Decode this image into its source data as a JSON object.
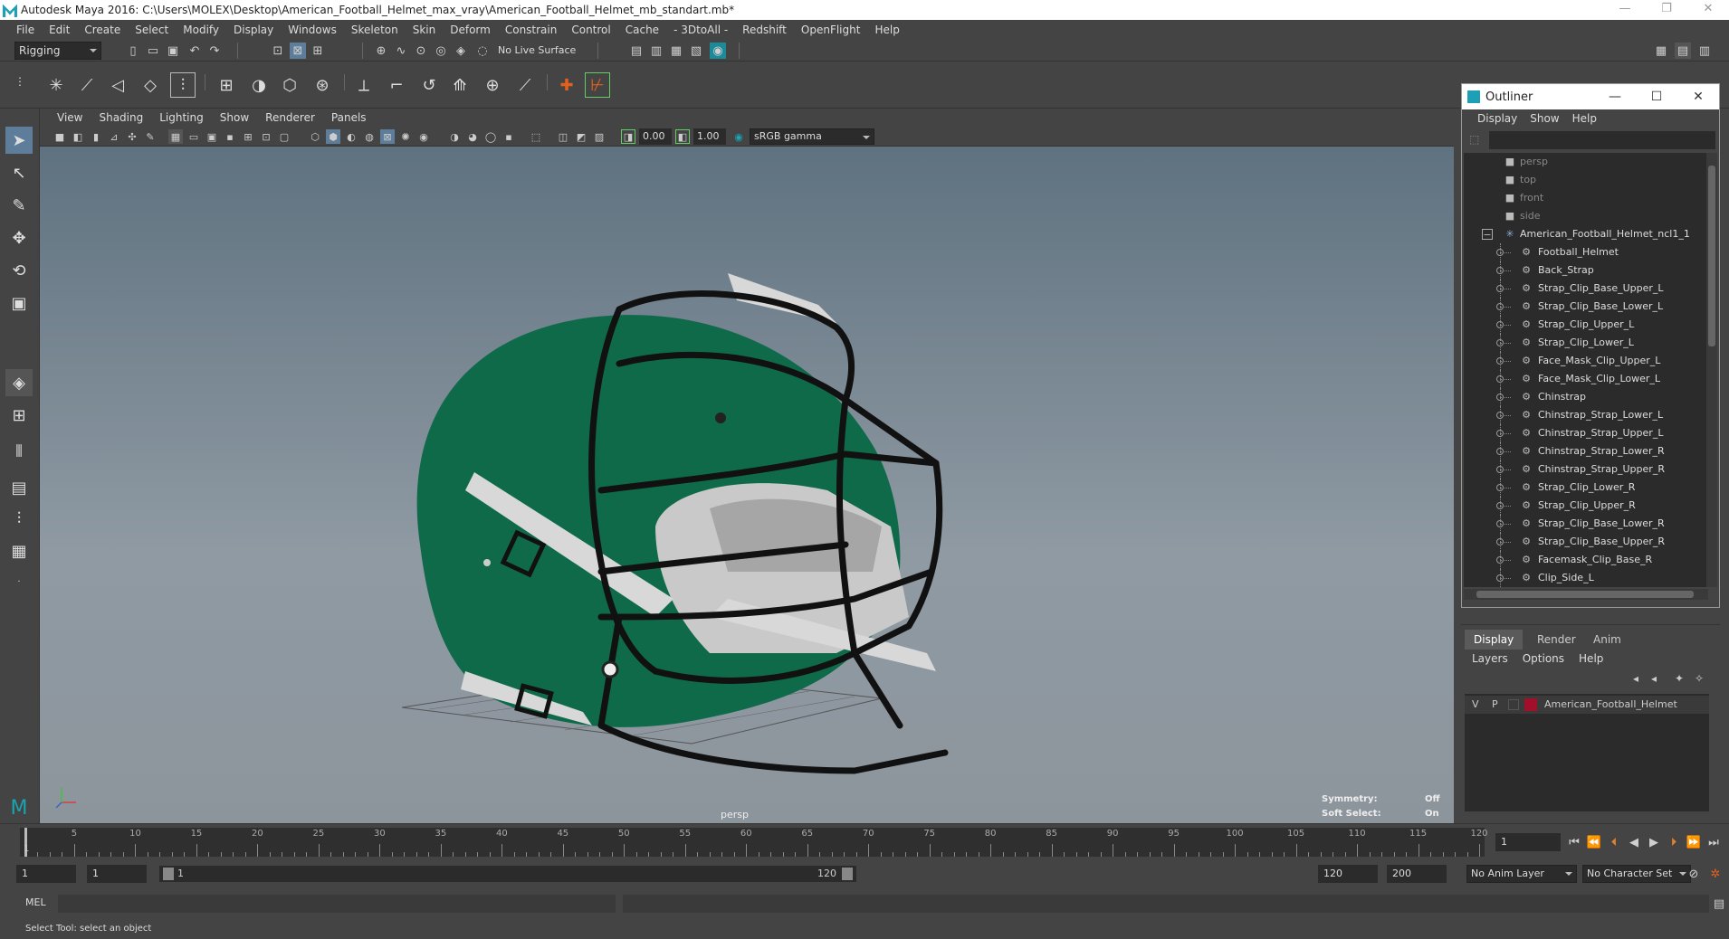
{
  "window": {
    "title": "Autodesk Maya 2016: C:\\Users\\MOLEX\\Desktop\\American_Football_Helmet_max_vray\\American_Football_Helmet_mb_standart.mb*",
    "minimize_glyph": "—",
    "restore_glyph": "❐",
    "close_glyph": "✕"
  },
  "menubar": [
    "File",
    "Edit",
    "Create",
    "Select",
    "Modify",
    "Display",
    "Windows",
    "Skeleton",
    "Skin",
    "Deform",
    "Constrain",
    "Control",
    "Cache",
    "- 3DtoAll -",
    "Redshift",
    "OpenFlight",
    "Help"
  ],
  "statusline": {
    "mode": "Rigging",
    "live_surface": "No Live Surface"
  },
  "panel": {
    "menus": [
      "View",
      "Shading",
      "Lighting",
      "Show",
      "Renderer",
      "Panels"
    ],
    "exposure": "0.00",
    "gamma": "1.00",
    "colorspace": "sRGB gamma"
  },
  "viewport": {
    "camera": "persp",
    "symmetry_label": "Symmetry:",
    "symmetry_value": "Off",
    "soft_select_label": "Soft Select:",
    "soft_select_value": "On",
    "helmet_color": "#0f6a4a"
  },
  "outliner": {
    "title": "Outliner",
    "menus": [
      "Display",
      "Show",
      "Help"
    ],
    "cameras": [
      "persp",
      "top",
      "front",
      "side"
    ],
    "group": "American_Football_Helmet_ncl1_1",
    "collapse_glyph": "−",
    "items": [
      "Football_Helmet",
      "Back_Strap",
      "Strap_Clip_Base_Upper_L",
      "Strap_Clip_Base_Lower_L",
      "Strap_Clip_Upper_L",
      "Strap_Clip_Lower_L",
      "Face_Mask_Clip_Upper_L",
      "Face_Mask_Clip_Lower_L",
      "Chinstrap",
      "Chinstrap_Strap_Lower_L",
      "Chinstrap_Strap_Upper_L",
      "Chinstrap_Strap_Lower_R",
      "Chinstrap_Strap_Upper_R",
      "Strap_Clip_Lower_R",
      "Strap_Clip_Upper_R",
      "Strap_Clip_Base_Lower_R",
      "Strap_Clip_Base_Upper_R",
      "Facemask_Clip_Base_R",
      "Clip_Side_L"
    ]
  },
  "layers": {
    "tabs": [
      "Display",
      "Render",
      "Anim"
    ],
    "menus": [
      "Layers",
      "Options",
      "Help"
    ],
    "layer_v": "V",
    "layer_p": "P",
    "layer_name": "American_Football_Helmet",
    "layer_color": "#a0102a"
  },
  "timeline": {
    "ticks": [
      5,
      10,
      15,
      20,
      25,
      30,
      35,
      40,
      45,
      50,
      55,
      60,
      65,
      70,
      75,
      80,
      85,
      90,
      95,
      100,
      105,
      110,
      115,
      120
    ],
    "start_label": "1",
    "current_frame": "1"
  },
  "range": {
    "start": "1",
    "playback_start": "1",
    "slider_start": "1",
    "slider_end": "120",
    "playback_end": "120",
    "end": "200",
    "anim_layer": "No Anim Layer",
    "character_set": "No Character Set"
  },
  "cmdline": {
    "label": "MEL"
  },
  "helpline": {
    "text": "Select Tool: select an object"
  }
}
